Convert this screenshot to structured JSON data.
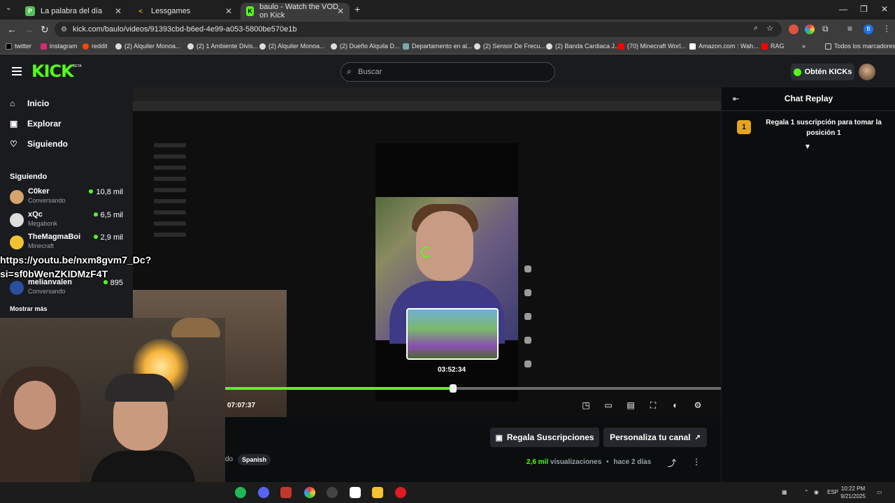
{
  "browser": {
    "tabs": [
      {
        "title": "La palabra del día",
        "favicon": "P",
        "color": "#53c15a"
      },
      {
        "title": "Lessgames",
        "favicon": "L",
        "color": "#e0b400"
      },
      {
        "title": "baulo - Watch the VOD on Kick",
        "favicon": "K",
        "color": "#53fc18"
      }
    ],
    "url": "kick.com/baulo/videos/91393cbd-b6ed-4e99-a053-5800be570e1b",
    "bookmarks": [
      {
        "label": "twitter"
      },
      {
        "label": "instagram"
      },
      {
        "label": "reddit"
      },
      {
        "label": "(2) Alquiler Monoa..."
      },
      {
        "label": "(2) 1 Ambiente Divis..."
      },
      {
        "label": "(2) Alquiler Monoa..."
      },
      {
        "label": "(2) Dueño Alquila D..."
      },
      {
        "label": "Departamento en al..."
      },
      {
        "label": "(2) Sensor De Frecu..."
      },
      {
        "label": "(2) Banda Cardiaca J..."
      },
      {
        "label": "(70) Minecraft Worl..."
      },
      {
        "label": "Amazon.com : Wah..."
      },
      {
        "label": "RAG"
      }
    ],
    "all_bookmarks": "Todos los marcadores"
  },
  "kick": {
    "logo": "KICK",
    "beta": "BETA",
    "search_placeholder": "Buscar",
    "get_kicks": "Obtén KICKs",
    "accent": "#53fc18"
  },
  "sidebar": {
    "nav": [
      {
        "label": "Inicio",
        "icon": "home-icon"
      },
      {
        "label": "Explorar",
        "icon": "browse-icon"
      },
      {
        "label": "Siguiendo",
        "icon": "heart-icon"
      }
    ],
    "following_heading": "Siguiendo",
    "following": [
      {
        "name": "C0ker",
        "category": "Conversando",
        "viewers": "10,8 mil"
      },
      {
        "name": "xQc",
        "category": "Megabonk",
        "viewers": "6,5 mil"
      },
      {
        "name": "TheMagmaBoi",
        "category": "Minecraft",
        "viewers": "2,9 mil"
      },
      {
        "name": "melianvalen",
        "category": "Conversando",
        "viewers": "895"
      }
    ],
    "show_more": "Mostrar más"
  },
  "overlay_caption": {
    "line1": "https://youtu.be/nxm8gvm7_Dc?",
    "line2": "si=sf0bWenZKIDMzF4T"
  },
  "player": {
    "hover_time": "03:52:34",
    "current_time": "07:07:37",
    "progress_fraction": 0.46,
    "controls": [
      "pip-icon",
      "theater-icon",
      "miniplayer-icon",
      "fullscreen-icon",
      "speed-icon",
      "settings-icon"
    ]
  },
  "below": {
    "gift_button": "Regala Suscripciones",
    "customize_button": "Personaliza tu canal",
    "language_tag": "Spanish",
    "partial_text": "do",
    "views_count": "2,6 mil",
    "views_label": "visualizaciones",
    "separator": "•",
    "posted": "hace 2 días"
  },
  "chat": {
    "title": "Chat Replay",
    "pinned_rank": "1",
    "pinned_text": "Regala 1 suscripción para tomar la posición 1"
  },
  "taskbar": {
    "lang": "ESP",
    "time": "10:22 PM",
    "date": "9/21/2025"
  }
}
